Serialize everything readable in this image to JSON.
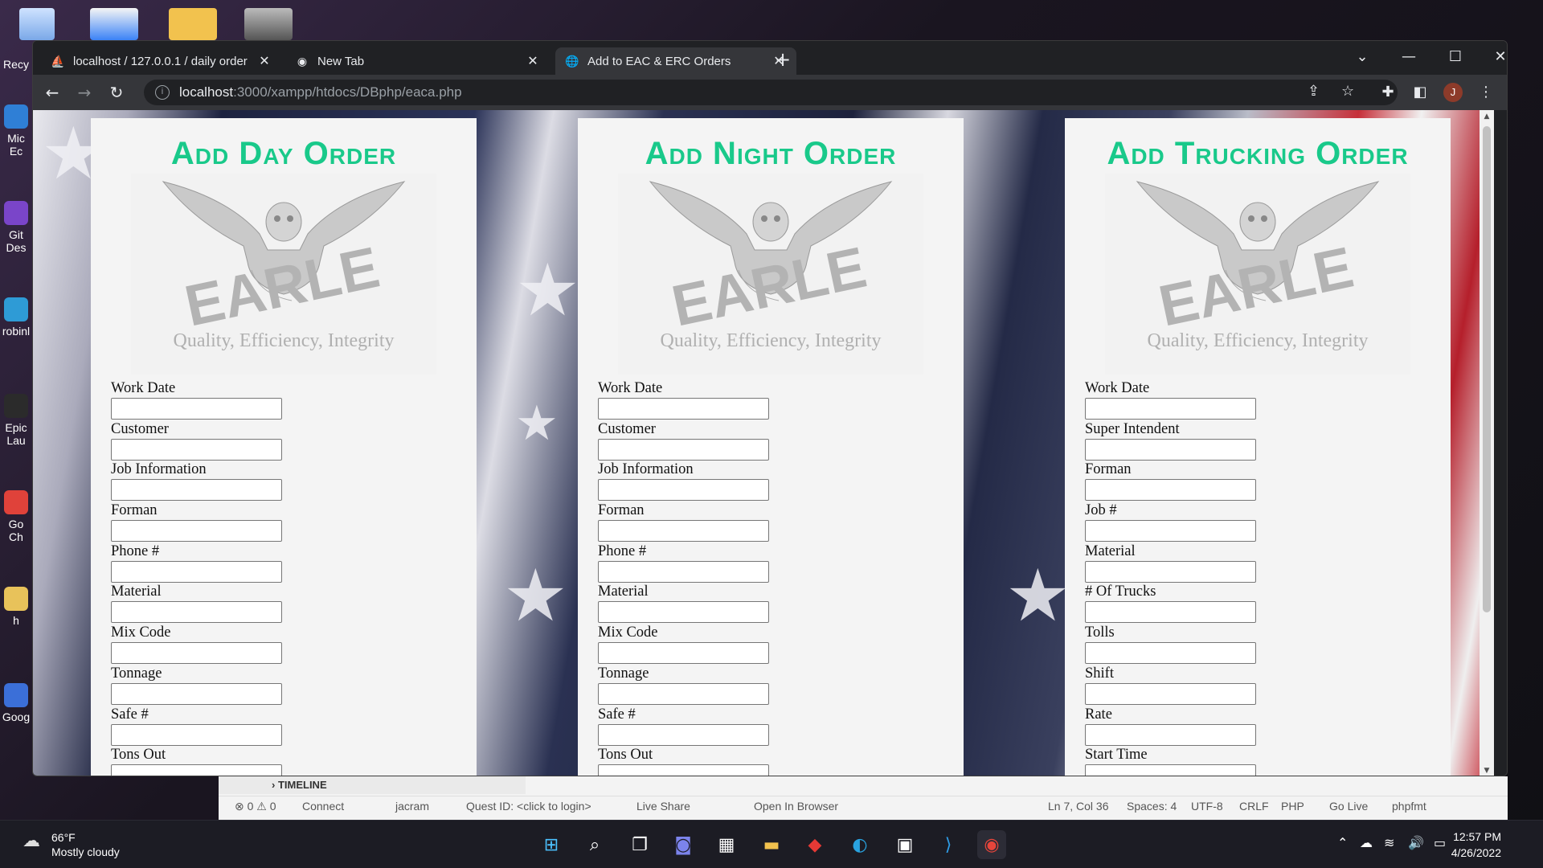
{
  "desktop": {
    "icons": [
      {
        "label": "Recy",
        "color": "#9ec5ff"
      },
      {
        "label": "Mic Ec",
        "color": "#2f7fd6"
      },
      {
        "label": "Git Des",
        "color": "#7a45c9"
      },
      {
        "label": "robinl",
        "color": "#2e9bd6"
      },
      {
        "label": "Epic Lau",
        "color": "#2b2b2b"
      },
      {
        "label": "Go Ch",
        "color": "#e0423a"
      },
      {
        "label": "h",
        "color": "#e8c25a"
      },
      {
        "label": "Goog",
        "color": "#3b6fd8"
      }
    ]
  },
  "browser": {
    "tabs": [
      {
        "label": "localhost / 127.0.0.1 / daily order",
        "icon": "phpmyadmin-icon",
        "active": false
      },
      {
        "label": "New Tab",
        "icon": "chrome-icon",
        "active": false
      },
      {
        "label": "Add to EAC & ERC Orders",
        "icon": "globe-icon",
        "active": true
      }
    ],
    "url_host": "localhost",
    "url_path": ":3000/xampp/htdocs/DBphp/eaca.php",
    "profile_initial": "J"
  },
  "page": {
    "panels": [
      {
        "title": "Add Day Order",
        "logo_word": "EARLE",
        "logo_motto": "Quality, Efficiency, Integrity",
        "fields": [
          "Work Date",
          "Customer",
          "Job Information",
          "Forman",
          "Phone #",
          "Material",
          "Mix Code",
          "Tonnage",
          "Safe #",
          "Tons Out"
        ]
      },
      {
        "title": "Add Night Order",
        "logo_word": "EARLE",
        "logo_motto": "Quality, Efficiency, Integrity",
        "fields": [
          "Work Date",
          "Customer",
          "Job Information",
          "Forman",
          "Phone #",
          "Material",
          "Mix Code",
          "Tonnage",
          "Safe #",
          "Tons Out"
        ]
      },
      {
        "title": "Add Trucking Order",
        "logo_word": "EARLE",
        "logo_motto": "Quality, Efficiency, Integrity",
        "fields": [
          "Work Date",
          "Super Intendent",
          "Forman",
          "Job #",
          "Material",
          "# Of Trucks",
          "Tolls",
          "Shift",
          "Rate",
          "Start Time"
        ]
      }
    ]
  },
  "vscode": {
    "timeline_label": "TIMELINE",
    "status": {
      "problems": "⊗ 0 ⚠ 0",
      "connect": "Connect",
      "user": "jacram",
      "quest": "Quest ID: <click to login>",
      "live_share": "Live Share",
      "open_browser": "Open In Browser",
      "position": "Ln 7, Col 36",
      "spaces": "Spaces: 4",
      "encoding": "UTF-8",
      "eol": "CRLF",
      "language": "PHP",
      "go_live": "Go Live",
      "formatter": "phpfmt"
    }
  },
  "taskbar": {
    "temp": "66°F",
    "condition": "Mostly cloudy",
    "time": "12:57 PM",
    "date": "4/26/2022"
  }
}
